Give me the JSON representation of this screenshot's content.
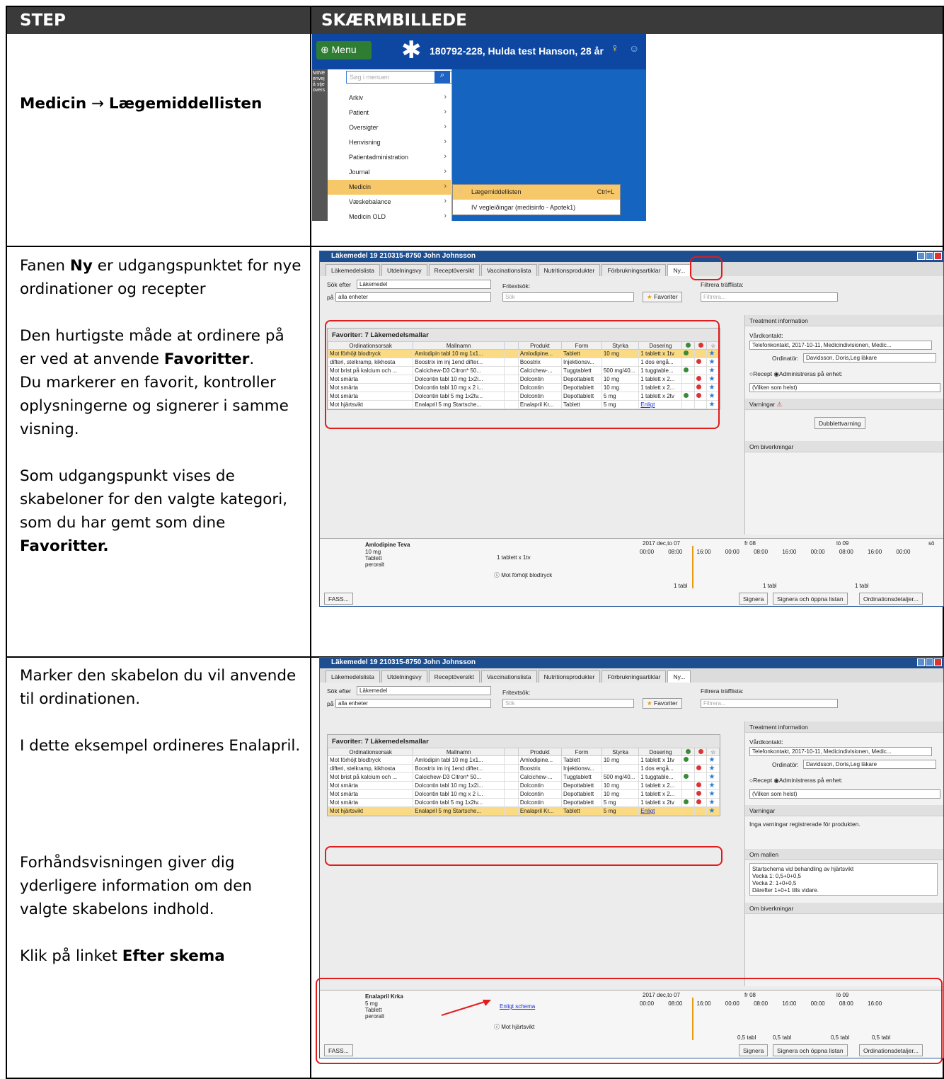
{
  "header": {
    "step": "STEP",
    "screenshot": "SKÆRMBILLEDE"
  },
  "step1": {
    "label_a": "Medicin",
    "arrow": "→",
    "label_b": "Lægemiddellisten"
  },
  "step2": {
    "l1a": "Fanen ",
    "l1b": "Ny",
    "l1c": " er udgangspunktet for nye ordinationer og recepter",
    "l2": "Den hurtigste måde at ordinere på er ved at anvende ",
    "l2b": "Favoritter",
    "l2c": ".",
    "l3": "Du markerer en favorit, kontroller oplysningerne og signerer i samme visning.",
    "l4": "Som udgangspunkt vises de skabeloner for den valgte kategori, som du har gemt som dine ",
    "l4b": "Favoritter."
  },
  "step3": {
    "l1": "Marker den skabelon du vil anvende til ordinationen.",
    "l2": "I dette eksempel ordineres Enalapril.",
    "l3": "Forhåndsvisningen giver dig yderligere information om den valgte skabelons indhold.",
    "l4a": "Klik på linket ",
    "l4b": "Efter skema"
  },
  "shot1": {
    "menu": "Menu",
    "patient": "180792-228,  Hulda test Hanson, 28 år",
    "left_text": "MINE envej å stje overs",
    "search": "Søg i menuen",
    "items": [
      "Arkiv",
      "Patient",
      "Oversigter",
      "Henvisning",
      "Patientadministration",
      "Journal",
      "Medicin",
      "Væskebalance",
      "Medicin OLD"
    ],
    "sub": [
      "Lægemiddellisten",
      "IV vegleiðingar (medisinfo - Apotek1)"
    ],
    "shortcut": "Ctrl+L"
  },
  "app": {
    "title": "Läkemedel 19 210315-8750 John Johnsson",
    "tabs": [
      "Läkemedelslista",
      "Utdelningsvy",
      "Receptöversikt",
      "Vaccinationslista",
      "Nutritionsprodukter",
      "Förbrukningsartiklar",
      "Ny..."
    ],
    "sok_efter": "Sök efter",
    "sok_val": "Läkemedel",
    "pa": "på",
    "pa_val": "alla enheter",
    "fritext": "Fritextsök:",
    "sok_ph": "Sök",
    "favoriter": "Favoriter",
    "filtrera": "Filtrera träfflista:",
    "filtrera_ph": "Filtrera...",
    "fav_title": "Favoriter: 7 Läkemedelsmallar",
    "cols": [
      "Ordinationsorsak",
      "Mallnamn",
      "",
      "Produkt",
      "Form",
      "Styrka",
      "Dosering",
      "",
      "",
      ""
    ],
    "rows": [
      [
        "Mot förhöjt blodtryck",
        "Amlodipin tabl 10 mg 1x1...",
        "",
        "Amlodipine...",
        "Tablett",
        "10 mg",
        "1 tablett x 1tv",
        "g",
        "",
        "s"
      ],
      [
        "difteri, stelkramp, kikhosta",
        "Boostrix im inj 1end difter...",
        "",
        "Boostrix",
        "Injektionsv...",
        "",
        "1 dos engå...",
        "",
        "r",
        "s"
      ],
      [
        "Mot brist på kalcium och ...",
        "Calcichew-D3 Citron* 50...",
        "",
        "Calcichew-...",
        "Tuggtablett",
        "500 mg/40...",
        "1 tuggtable...",
        "g",
        "",
        "s"
      ],
      [
        "Mot smärta",
        "Dolcontin tabl 10 mg 1x2i...",
        "",
        "Dolcontin",
        "Depottablett",
        "10 mg",
        "1 tablett x 2...",
        "",
        "r",
        "s"
      ],
      [
        "Mot smärta",
        "Dolcontin tabl 10 mg x 2 i...",
        "",
        "Dolcontin",
        "Depottablett",
        "10 mg",
        "1 tablett x 2...",
        "",
        "r",
        "s"
      ],
      [
        "Mot smärta",
        "Dolcontin tabl 5 mg 1x2tv...",
        "",
        "Dolcontin",
        "Depottablett",
        "5 mg",
        "1 tablett x 2tv",
        "g",
        "r",
        "s"
      ],
      [
        "Mot hjärtsvikt",
        "Enalapril 5 mg Startsche...",
        "",
        "Enalapril Kr...",
        "Tablett",
        "5 mg",
        "Enligt",
        "",
        "",
        "s"
      ]
    ],
    "treat": "Treatment information",
    "vardkontakt": "Vårdkontakt:",
    "vk_val": "Telefonkontakt, 2017-10-11, Medicindivisionen, Medic...",
    "ordinator": "Ordinatör:",
    "ord_val": "Davidsson, Doris,Leg läkare",
    "recept": "Recept",
    "admin": "Administreras på enhet:",
    "vilken": "(Vilken som helst)",
    "varningar": "Varningar",
    "dubblett": "Dubblettvarning",
    "om_biv": "Om biverkningar",
    "inga_varn": "Inga varningar registrerade för produkten.",
    "om_mallen": "Om mallen",
    "mallen_text": [
      "Startschema vid behandling av hjärtsvikt",
      "Vecka 1: 0,5+0+0,5",
      "Vecka 2: 1+0+0,5",
      "Därefter 1+0+1 tills vidare."
    ],
    "fass": "FASS...",
    "signera": "Signera",
    "signera_oppna": "Signera och öppna listan",
    "ord_det": "Ordinationsdetaljer...",
    "tl_days": [
      "2017 dec,to 07",
      "fr 08",
      "lö 09",
      "sö"
    ],
    "tl_hours": [
      "00:00",
      "08:00",
      "16:00",
      "00:00",
      "08:00",
      "16:00",
      "00:00",
      "08:00",
      "16:00",
      "00:00"
    ],
    "p1": {
      "name": "Amlodipine Teva",
      "str": "10 mg",
      "form": "Tablett",
      "route": "peroralt",
      "dose": "1 tablett x 1tv",
      "reason": "Mot förhöjt blodtryck",
      "tabl": "1 tabl"
    },
    "p2": {
      "name": "Enalapril Krka",
      "str": "5 mg",
      "form": "Tablett",
      "route": "peroralt",
      "dose": "Enligt schema",
      "reason": "Mot hjärtsvikt",
      "tabl": "0,5 tabl"
    }
  }
}
